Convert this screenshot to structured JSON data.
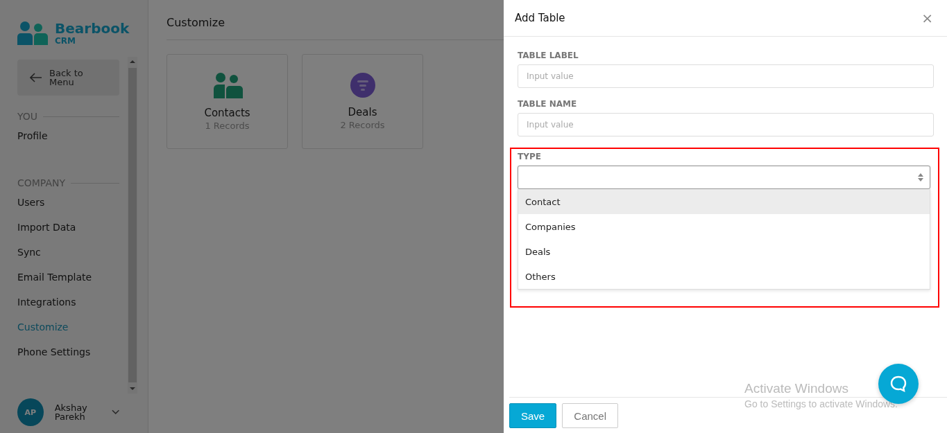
{
  "brand": {
    "name": "Bearbook",
    "sub": "CRM"
  },
  "sidebar": {
    "back_button": "Back to\nMenu",
    "sections": [
      {
        "title": "YOU",
        "items": [
          {
            "label": "Profile",
            "selected": false
          }
        ]
      },
      {
        "title": "COMPANY",
        "items": [
          {
            "label": "Users",
            "selected": false
          },
          {
            "label": "Import Data",
            "selected": false
          },
          {
            "label": "Sync",
            "selected": false
          },
          {
            "label": "Email Template",
            "selected": false
          },
          {
            "label": "Integrations",
            "selected": false
          },
          {
            "label": "Customize",
            "selected": true
          },
          {
            "label": "Phone Settings",
            "selected": false
          }
        ]
      }
    ],
    "user": {
      "initials": "AP",
      "name": "Akshay\nParekh"
    }
  },
  "main": {
    "title": "Customize",
    "cards": [
      {
        "kind": "contacts",
        "title": "Contacts",
        "count": "1 Records"
      },
      {
        "kind": "deals",
        "title": "Deals",
        "count": "2 Records"
      }
    ]
  },
  "drawer": {
    "title": "Add Table",
    "close": "×",
    "fields": [
      {
        "label": "TABLE LABEL",
        "placeholder": "Input value"
      },
      {
        "label": "TABLE NAME",
        "placeholder": "Input value"
      }
    ],
    "type_field": {
      "label": "TYPE",
      "expanded": true,
      "options": [
        {
          "label": "Contact",
          "selected": true
        },
        {
          "label": "Companies",
          "selected": false
        },
        {
          "label": "Deals",
          "selected": false
        },
        {
          "label": "Others",
          "selected": false
        }
      ]
    },
    "buttons": [
      {
        "kind": "primary",
        "label": "Save"
      },
      {
        "kind": "secondary",
        "label": "Cancel"
      }
    ]
  },
  "os_notice": {
    "title": "Activate Windows",
    "text": "Go to Settings to activate Windows."
  }
}
